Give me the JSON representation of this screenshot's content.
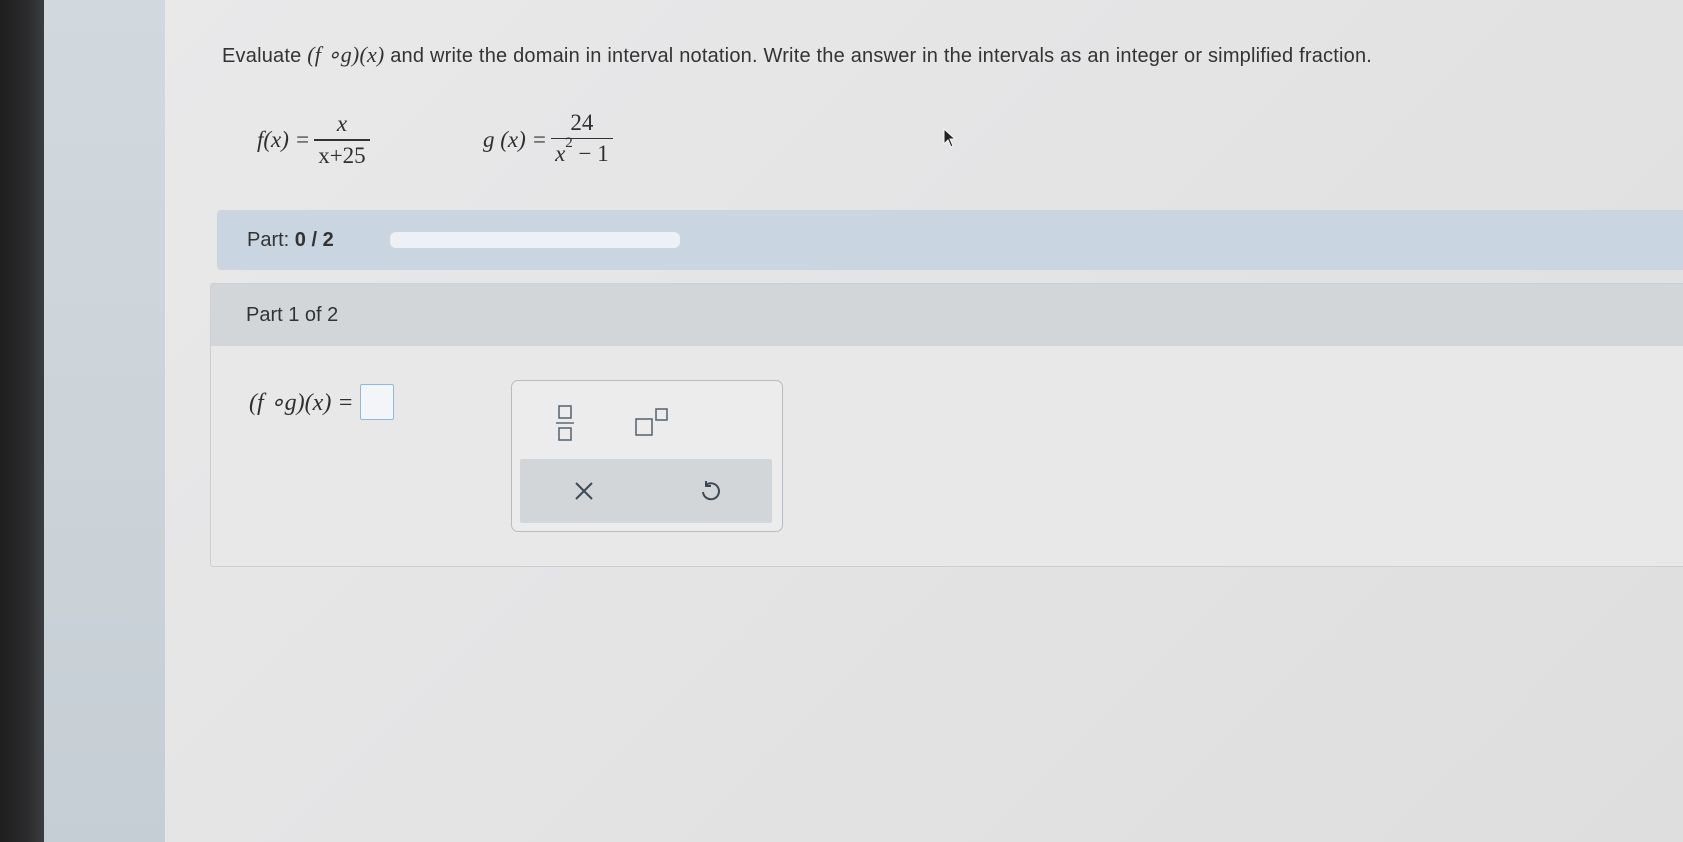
{
  "question": {
    "prefix": "Evaluate ",
    "composition": "(f ∘g)(x)",
    "suffix": " and write the domain in interval notation. Write the answer in the intervals as an integer or simplified fraction."
  },
  "functions": {
    "f": {
      "name": "f(x) =",
      "numerator": "x",
      "denominator_left": "x+25",
      "denominator_right": ""
    },
    "g": {
      "name": "g (x) =",
      "numerator": "24",
      "denominator_base": "x",
      "denominator_exp": "2",
      "denominator_rest": " − 1"
    }
  },
  "progress": {
    "label": "Part: ",
    "value": "0 / 2",
    "fraction_complete": 0
  },
  "section": {
    "title": "Part 1 of 2",
    "answer_lhs": "(f ∘g)(x) =",
    "answer_value": ""
  },
  "palette": {
    "buttons": [
      "fraction-template",
      "exponent-template"
    ],
    "actions": [
      "clear",
      "undo"
    ]
  },
  "colors": {
    "progress_bar_bg": "#c9d5e0",
    "section_header_bg": "#d3d6d8",
    "answer_box_border": "#8fb8de"
  }
}
